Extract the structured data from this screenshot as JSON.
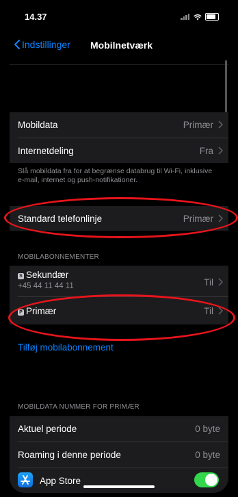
{
  "status": {
    "time": "14.37"
  },
  "nav": {
    "back_label": "Indstillinger",
    "title": "Mobilnetværk"
  },
  "section1": {
    "rows": [
      {
        "label": "Mobildata",
        "value": "Primær"
      },
      {
        "label": "Internetdeling",
        "value": "Fra"
      }
    ],
    "footer": "Slå mobildata fra for at begrænse databrug til Wi-Fi, inklusive e-mail, internet og push-notifikationer."
  },
  "default_line": {
    "label": "Standard telefonlinje",
    "value": "Primær"
  },
  "plans": {
    "header": "MOBILABONNEMENTER",
    "items": [
      {
        "badge": "S",
        "label": "Sekundær",
        "number": "+45 44 11 44 11",
        "value": "Til"
      },
      {
        "badge": "P",
        "label": "Primær",
        "value": "Til"
      }
    ],
    "add_label": "Tilføj mobilabonnement"
  },
  "data_section": {
    "header": "MOBILDATA NUMMER FOR PRIMÆR",
    "rows": [
      {
        "label": "Aktuel periode",
        "value": "0 byte"
      },
      {
        "label": "Roaming i denne periode",
        "value": "0 byte"
      }
    ],
    "app": {
      "label": "App Store",
      "enabled": true,
      "icon": "app-store-icon"
    }
  },
  "colors": {
    "accent": "#0a84ff",
    "toggle_on": "#32d74b",
    "annotation": "#e8141b"
  }
}
